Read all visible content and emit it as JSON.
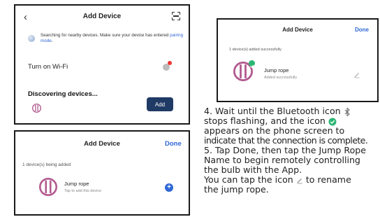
{
  "screen1": {
    "title": "Add Device",
    "back_icon": "chevron-left-icon",
    "scan_icon": "scan-icon",
    "search_text": "Searching for nearby devices. Make sure your device has entered",
    "pairing_link": "pairing mode",
    "search_text_end": ".",
    "wifi_label": "Turn on Wi-Fi",
    "discovering_label": "Discovering devices...",
    "add_button": "Add"
  },
  "screen2": {
    "title": "Add Device",
    "done_label": "Done",
    "count_label": "1 device(s) being added",
    "device_name": "Jump rope",
    "device_sub": "Tap to add this device",
    "add_icon": "plus-circle-icon"
  },
  "screen3": {
    "title": "Add Device",
    "done_label": "Done",
    "count_label": "1 device(s) added successfully",
    "device_name": "Jump rope",
    "device_sub": "Added successfully",
    "edit_icon": "pencil-icon"
  },
  "instructions": {
    "l1a": "4. Wait until the Bluetooth icon",
    "l2a": "stops flashing, and the icon",
    "l3": " appears on the phone screen to",
    "l4": "indicate that the connection is complete.",
    "l5": "5. Tap Done, then tap the Jump Rope",
    "l6": "Name to begin remotely controlling",
    "l7": "the bulb with the App.",
    "l8a": "You can tap the icon",
    "l8b": "to rename",
    "l9": "the jump rope."
  },
  "colors": {
    "accent_blue": "#2f67d6",
    "add_button_bg": "#1f3a64",
    "device_icon": "#b25a8e",
    "success_green": "#2bb673",
    "badge_red": "#e33333"
  }
}
